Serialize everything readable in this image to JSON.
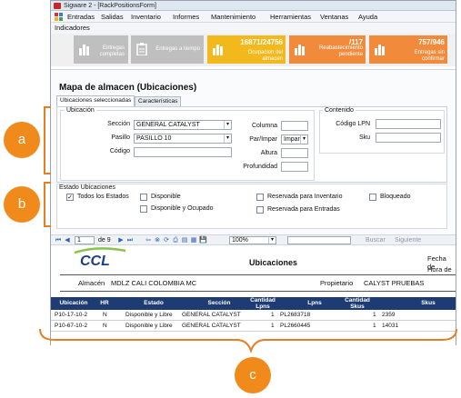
{
  "window": {
    "title": "Sigware 2 - [RackPositionsForm]"
  },
  "menu": {
    "items": [
      "Entradas",
      "Salidas",
      "Inventario",
      "Informes",
      "Mantenimiento",
      "Herramientas",
      "Ventanas",
      "Ayuda"
    ]
  },
  "indicators": {
    "label": "Indicadores",
    "tiles": [
      {
        "value": "",
        "label": "Entregas completas",
        "color": "#bfbfbf"
      },
      {
        "value": "",
        "label": "Entregas a tiempo",
        "color": "#bfbfbf"
      },
      {
        "value": "16871/24756",
        "label": "Ocupacion del almacen",
        "color": "#f3b81c"
      },
      {
        "value": "/117",
        "label": "Reabastecimiento pendiente",
        "color": "#f28a3c"
      },
      {
        "value": "757/946",
        "label": "Entregas sin confirmar",
        "color": "#f28a3c"
      }
    ]
  },
  "page": {
    "title": "Mapa de almacen (Ubicaciones)",
    "tabs": [
      "Ubicaciones seleccionadas",
      "Características"
    ]
  },
  "ubicacion": {
    "title": "Ubicación",
    "seccion_label": "Sección",
    "seccion_value": "GENERAL CATALYST",
    "pasillo_label": "Pasillo",
    "pasillo_value": "PASILLO 10",
    "codigo_label": "Código",
    "codigo_value": "",
    "columna_label": "Columna",
    "parimpar_label": "Par/Impar",
    "parimpar_value": "Impar",
    "altura_label": "Altura",
    "profundidad_label": "Profundidad"
  },
  "contenido": {
    "title": "Contenido",
    "lpn_label": "Código LPN",
    "sku_label": "Sku"
  },
  "estado": {
    "title": "Estado Ubicaciones",
    "options": [
      {
        "label": "Todos los Estados",
        "checked": true
      },
      {
        "label": "Disponible",
        "checked": false
      },
      {
        "label": "Disponible y Ocupado",
        "checked": false
      },
      {
        "label": "Reservada para Inventario",
        "checked": false
      },
      {
        "label": "Reservada para Entradas",
        "checked": false
      },
      {
        "label": "Bloqueado",
        "checked": false
      }
    ]
  },
  "report_toolbar": {
    "page_current": "1",
    "page_of": "de 9",
    "zoom": "100%",
    "find_label": "Buscar",
    "next_label": "Siguiente"
  },
  "report": {
    "logo_text": "CCL",
    "title": "Ubicaciones",
    "fecha_label": "Fecha de",
    "hora_label": "Hora de",
    "almacen_label": "Almacén",
    "almacen_value": "MDLZ CALI COLOMBIA MC",
    "propietario_label": "Propietario",
    "propietario_value": "CALYST PRUEBAS",
    "columns": [
      "Ubicación",
      "HR",
      "Estado",
      "Sección",
      "Cantidad Lpns",
      "Lpns",
      "Cantidad Skus",
      "Skus"
    ],
    "rows": [
      [
        "P10-17-10-2",
        "N",
        "Disponible y Libre",
        "GENERAL CATALYST",
        "1",
        "PL2683718",
        "1",
        "2359"
      ],
      [
        "P10-67-10-2",
        "N",
        "Disponible y Libre",
        "GENERAL CATALYST",
        "1",
        "PL2660445",
        "1",
        "14031"
      ]
    ]
  },
  "callouts": {
    "a": "a",
    "b": "b",
    "c": "c",
    "color": "#f08a1a"
  }
}
